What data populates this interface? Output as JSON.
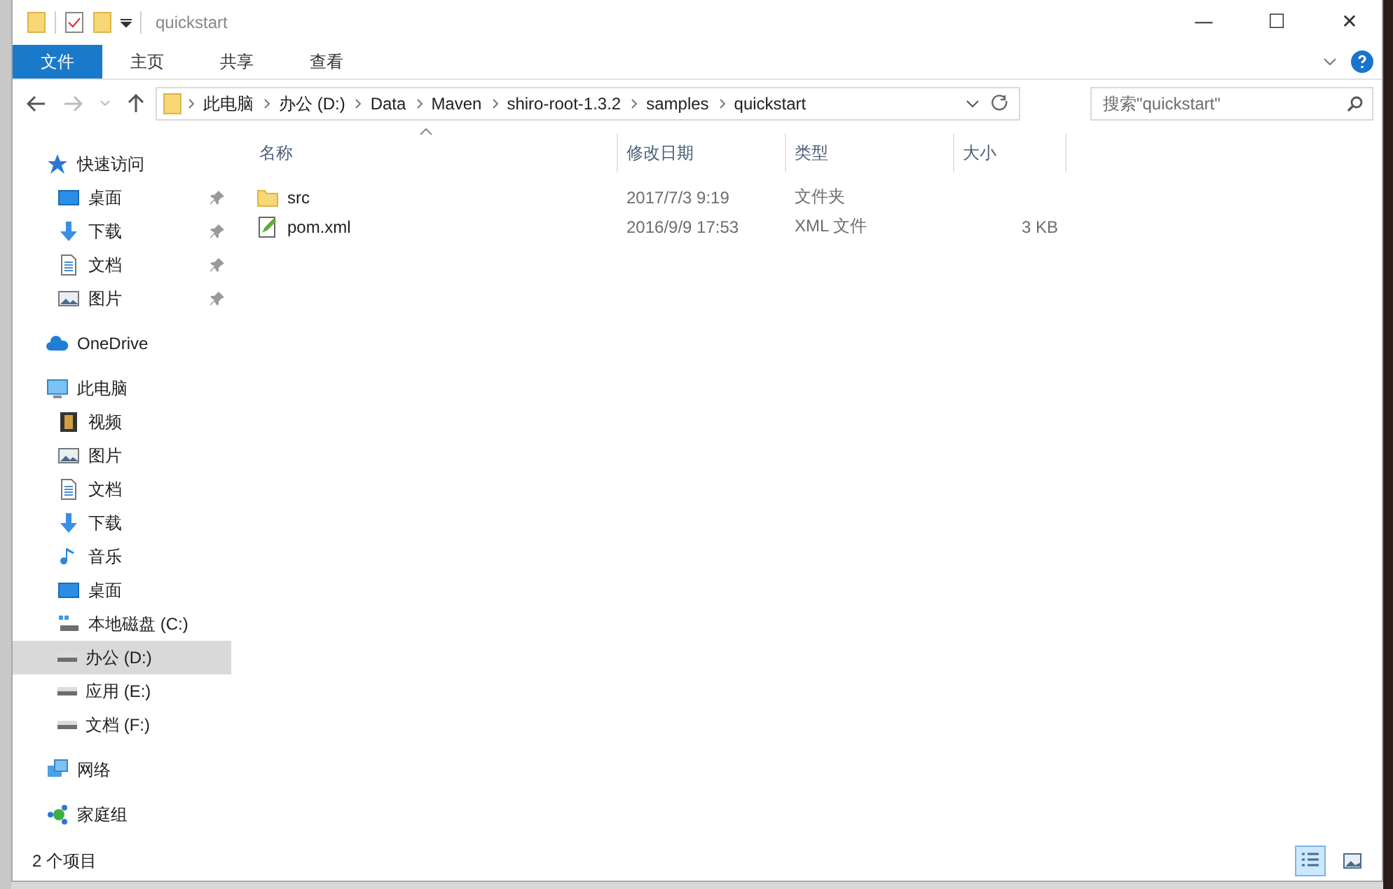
{
  "window": {
    "title": "quickstart",
    "controls": [
      "—",
      "☐",
      "✕"
    ]
  },
  "ribbon": {
    "tabs": [
      {
        "label": "文件",
        "kind": "file"
      },
      {
        "label": "主页",
        "kind": "tab"
      },
      {
        "label": "共享",
        "kind": "tab"
      },
      {
        "label": "查看",
        "kind": "tab"
      }
    ]
  },
  "address": {
    "crumbs": [
      "此电脑",
      "办公 (D:)",
      "Data",
      "Maven",
      "shiro-root-1.3.2",
      "samples",
      "quickstart"
    ]
  },
  "search": {
    "placeholder": "搜索\"quickstart\""
  },
  "sidebar": {
    "items": [
      {
        "label": "快速访问",
        "kind": "star",
        "selected": false,
        "children": [
          {
            "label": "桌面",
            "kind": "desktop",
            "pinned": true,
            "selected": false
          },
          {
            "label": "下载",
            "kind": "download",
            "pinned": true,
            "selected": false
          },
          {
            "label": "文档",
            "kind": "document",
            "pinned": true,
            "selected": false
          },
          {
            "label": "图片",
            "kind": "pictures",
            "pinned": true,
            "selected": false
          }
        ]
      },
      {
        "label": "OneDrive",
        "kind": "cloud",
        "selected": false
      },
      {
        "label": "此电脑",
        "kind": "computer",
        "selected": false,
        "children": [
          {
            "label": "视频",
            "kind": "video",
            "selected": false
          },
          {
            "label": "图片",
            "kind": "pictures",
            "selected": false
          },
          {
            "label": "文档",
            "kind": "document",
            "selected": false
          },
          {
            "label": "下载",
            "kind": "download",
            "selected": false
          },
          {
            "label": "音乐",
            "kind": "music",
            "selected": false
          },
          {
            "label": "桌面",
            "kind": "desktop",
            "selected": false
          },
          {
            "label": "本地磁盘 (C:)",
            "kind": "system-drive",
            "selected": false
          },
          {
            "label": "办公 (D:)",
            "kind": "drive",
            "selected": true
          },
          {
            "label": "应用 (E:)",
            "kind": "drive",
            "selected": false
          },
          {
            "label": "文档 (F:)",
            "kind": "drive",
            "selected": false
          }
        ]
      },
      {
        "label": "网络",
        "kind": "network",
        "selected": false
      },
      {
        "label": "家庭组",
        "kind": "homegroup",
        "selected": false
      }
    ]
  },
  "table": {
    "columns": [
      "名称",
      "修改日期",
      "类型",
      "大小"
    ],
    "rows": [
      {
        "kind": "folder",
        "name": "src",
        "modified": "2017/7/3 9:19",
        "type": "文件夹"
      },
      {
        "kind": "xml",
        "name": "pom.xml",
        "modified": "2016/9/9 17:53",
        "type": "XML 文件",
        "size": "3 KB"
      }
    ]
  },
  "status_bar": {
    "text": "2 个项目"
  }
}
